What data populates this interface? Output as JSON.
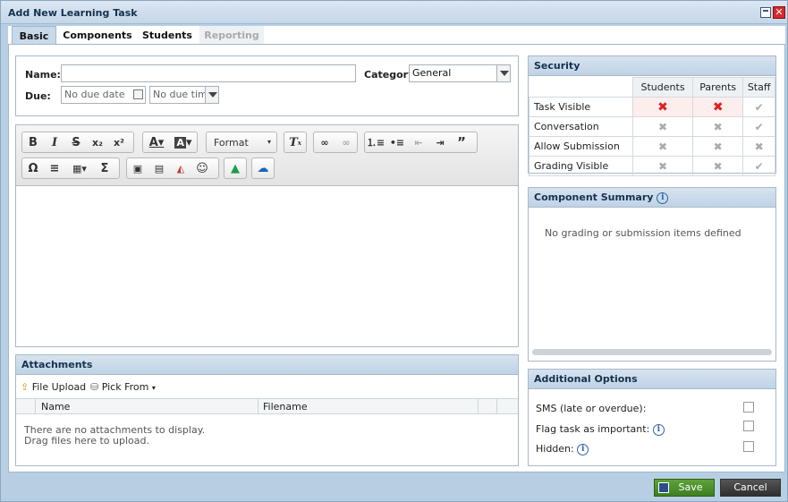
{
  "window": {
    "title": "Add New Learning Task"
  },
  "tabs": [
    {
      "label": "Basic"
    },
    {
      "label": "Components"
    },
    {
      "label": "Students"
    },
    {
      "label": "Reporting"
    }
  ],
  "form": {
    "name_label": "Name:",
    "name_value": "",
    "category_label": "Category:",
    "category_value": "General",
    "due_label": "Due:",
    "due_date_placeholder": "No due date",
    "due_time_placeholder": "No due time"
  },
  "editor": {
    "format_label": "Format"
  },
  "attachments": {
    "title": "Attachments",
    "file_upload": "File Upload",
    "pick_from": "Pick From",
    "col_name": "Name",
    "col_filename": "Filename",
    "empty_line1": "There are no attachments to display.",
    "empty_line2": "Drag files here to upload."
  },
  "security": {
    "title": "Security",
    "columns": [
      "Students",
      "Parents",
      "Staff"
    ],
    "rows": [
      {
        "label": "Task Visible",
        "values": [
          "cross-red",
          "cross-red",
          "check-grey"
        ]
      },
      {
        "label": "Conversation",
        "values": [
          "cross-grey",
          "cross-grey",
          "check-grey"
        ]
      },
      {
        "label": "Allow Submission",
        "values": [
          "cross-grey",
          "cross-grey",
          "cross-grey"
        ]
      },
      {
        "label": "Grading Visible",
        "values": [
          "cross-grey",
          "cross-grey",
          "check-grey"
        ]
      }
    ]
  },
  "component_summary": {
    "title": "Component Summary",
    "empty": "No grading or submission items defined"
  },
  "additional": {
    "title": "Additional Options",
    "sms": "SMS (late or overdue):",
    "flag": "Flag task as important:",
    "hidden": "Hidden:"
  },
  "footer": {
    "save": "Save",
    "cancel": "Cancel"
  },
  "colors": {
    "accent": "#4a8a2c",
    "cancel_bg": "#3c3c3c",
    "header_bg": "#bfd3e6"
  }
}
